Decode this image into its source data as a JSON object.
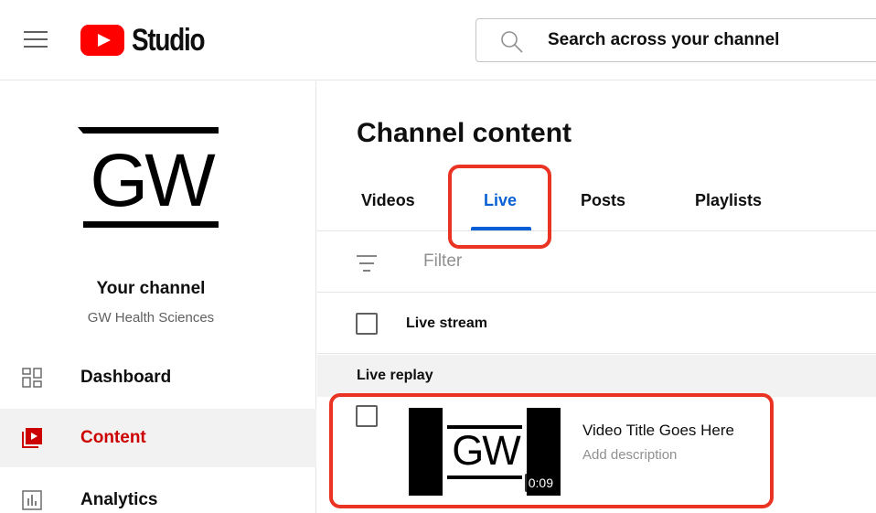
{
  "header": {
    "logo_text": "Studio",
    "search": {
      "placeholder": "Search across your channel"
    }
  },
  "sidebar": {
    "channel_title": "Your channel",
    "channel_name": "GW Health Sciences",
    "logo_text": "GW",
    "nav": [
      {
        "label": "Dashboard",
        "icon": "dashboard-icon"
      },
      {
        "label": "Content",
        "icon": "content-icon",
        "active": true
      },
      {
        "label": "Analytics",
        "icon": "analytics-icon"
      }
    ]
  },
  "main": {
    "title": "Channel content",
    "tabs": [
      {
        "label": "Videos"
      },
      {
        "label": "Live",
        "active": true
      },
      {
        "label": "Posts"
      },
      {
        "label": "Playlists"
      }
    ],
    "filter": {
      "placeholder": "Filter"
    },
    "column_header": "Live stream",
    "section": "Live replay",
    "video": {
      "thumb_text": "GW",
      "duration": "0:09",
      "title": "Video Title Goes Here",
      "description": "Add description"
    }
  },
  "colors": {
    "brand_red": "#ff0000",
    "active_red": "#cc0000",
    "tab_blue": "#065fd4",
    "annotation_red": "#ea3323"
  }
}
